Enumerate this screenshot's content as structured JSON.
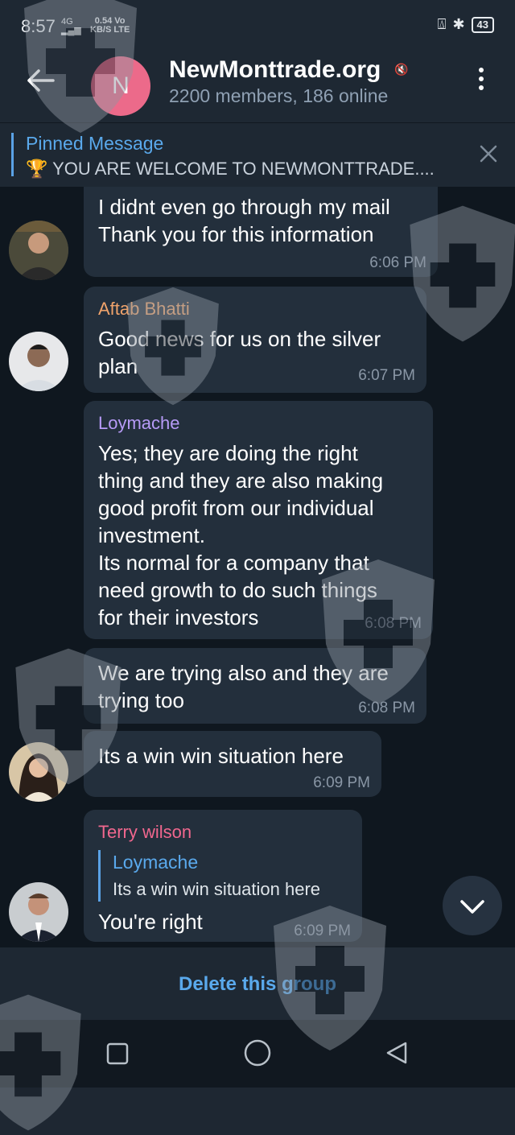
{
  "status": {
    "time": "8:57",
    "net": "4G",
    "speed_value": "0.54",
    "speed_unit": "KB/S",
    "vo": "Vo",
    "lte": "LTE",
    "battery": "43"
  },
  "header": {
    "avatar_letter": "N",
    "title": "NewMonttrade.org",
    "subtitle": "2200 members, 186 online"
  },
  "pinned": {
    "title": "Pinned Message",
    "text": "🏆 YOU ARE WELCOME TO NEWMONTTRADE...."
  },
  "messages": [
    {
      "text": "I didnt even go through my mail\nThank you for this information",
      "time": "6:06 PM"
    },
    {
      "sender": "Aftab Bhatti",
      "text": "Good news for us on the silver\nplan",
      "time": "6:07 PM"
    },
    {
      "sender": "Loymache",
      "text": "Yes; they are doing the right\nthing  and they are also making\ngood profit from our individual\ninvestment.\nIts normal for a company that\nneed growth to do such things\nfor their investors",
      "time": "6:08 PM"
    },
    {
      "text": "We are trying also and they are\ntrying too",
      "time": "6:08 PM"
    },
    {
      "text": "Its a win win situation here",
      "time": "6:09 PM"
    },
    {
      "sender": "Terry wilson",
      "reply_name": "Loymache",
      "reply_text": "Its a win win situation here",
      "text": "You're right",
      "time": "6:09 PM"
    }
  ],
  "footer": {
    "delete_label": "Delete this group"
  },
  "colors": {
    "accent": "#5aa9ec",
    "aftab": "#f0a36b",
    "loymache": "#b79bf7",
    "terry": "#f0678e",
    "avatar_bg": "#ec6a8a"
  }
}
